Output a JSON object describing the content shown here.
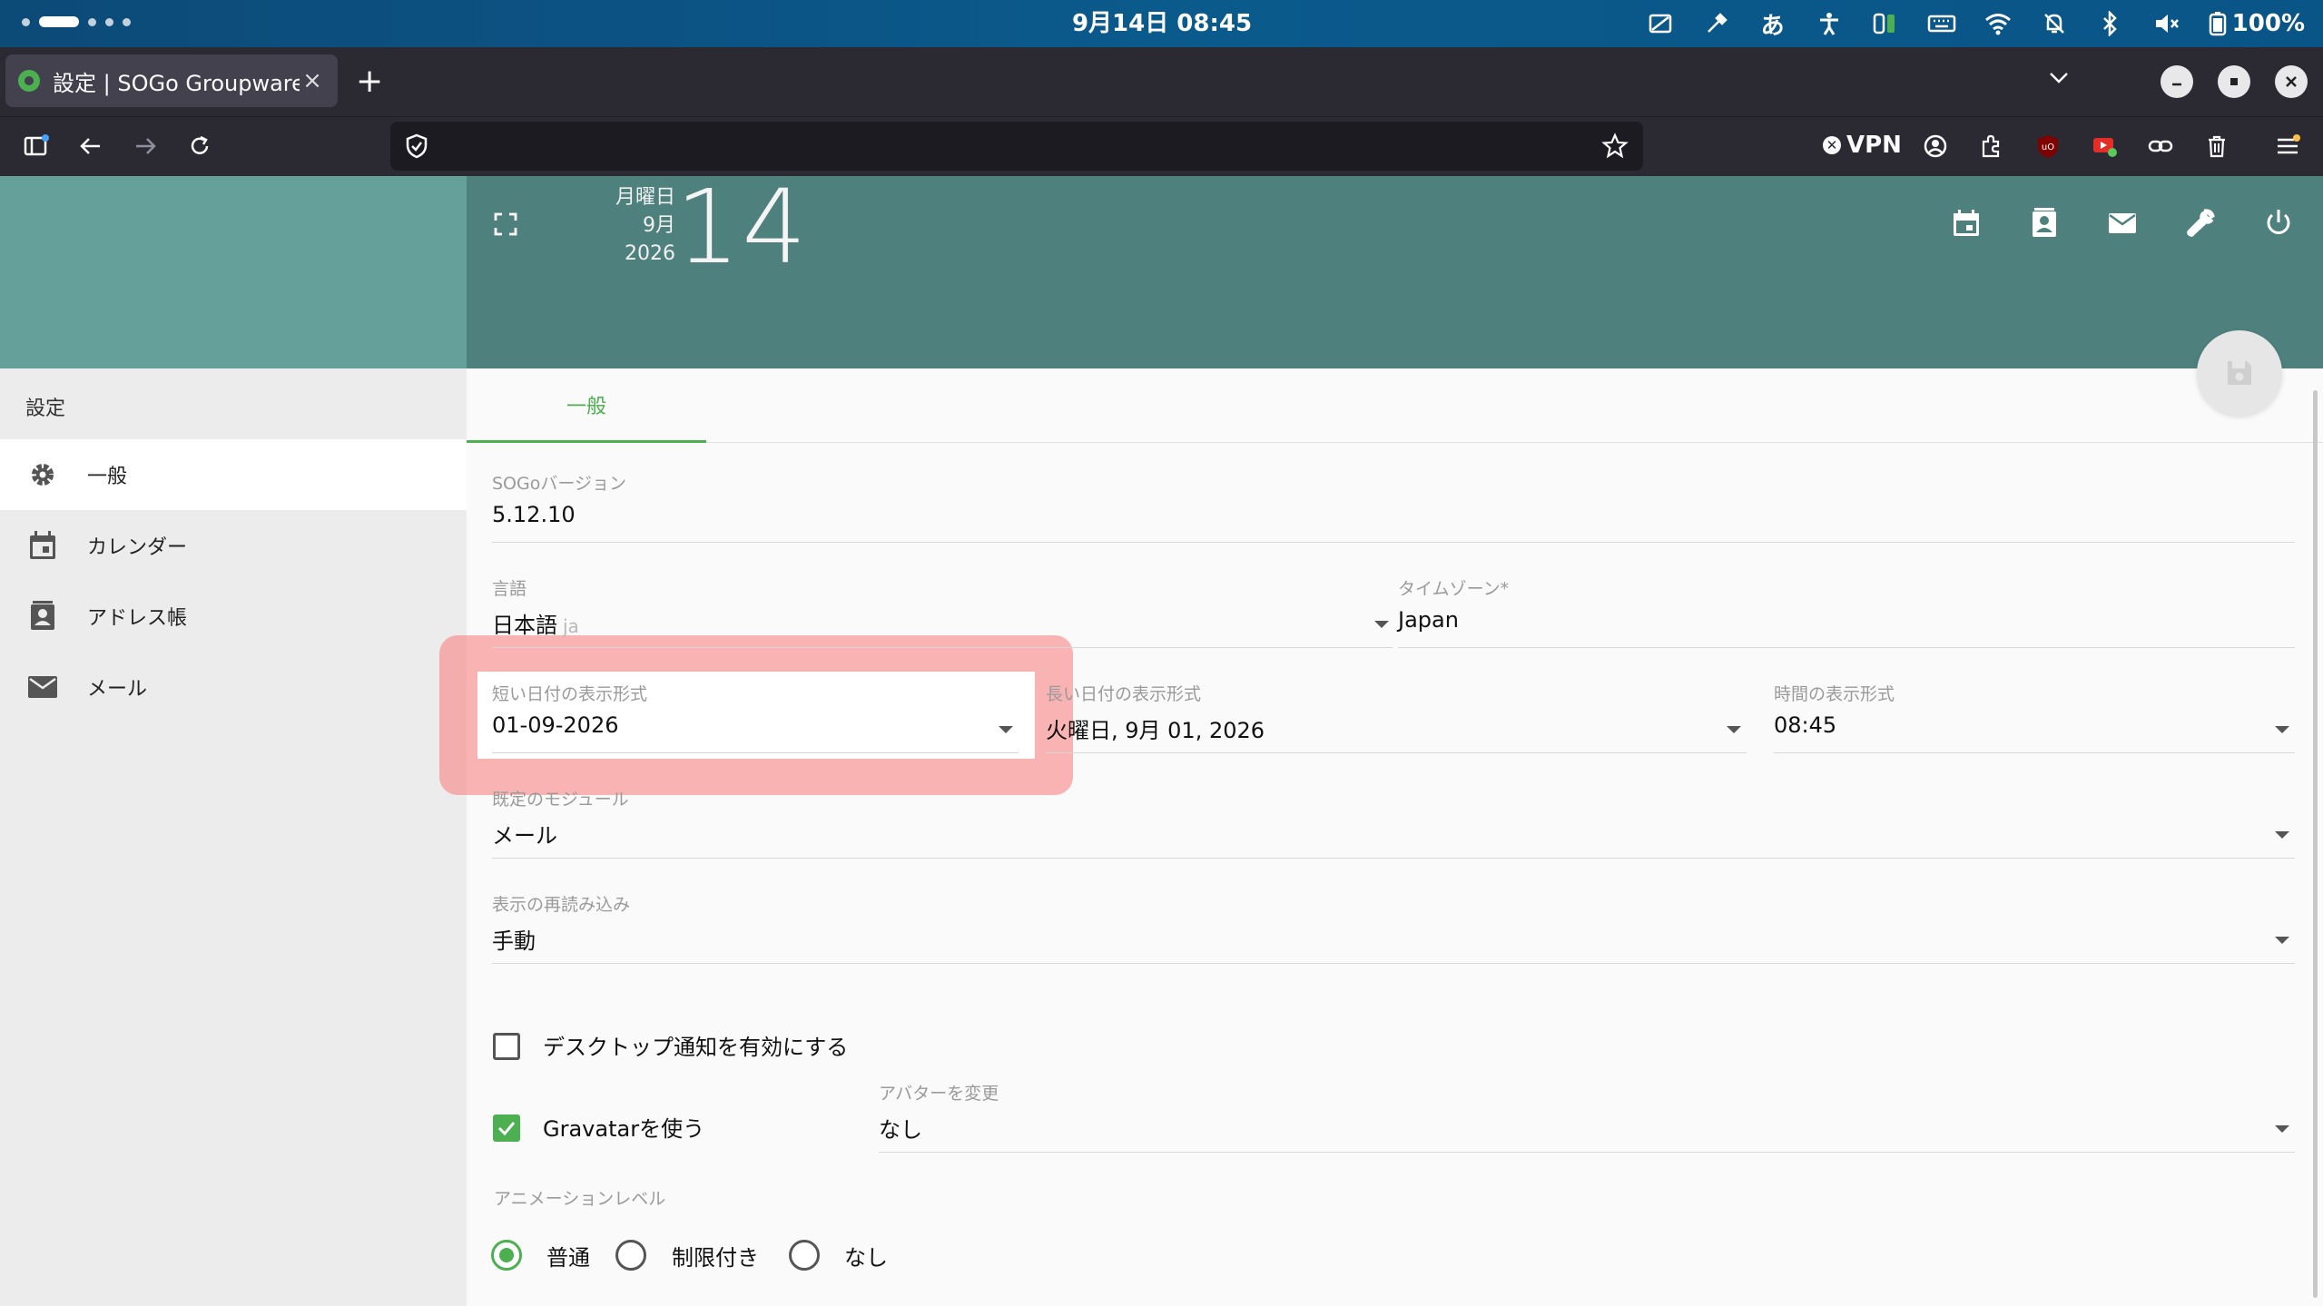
{
  "os": {
    "clock": "9月14日 08:45",
    "ime": "あ",
    "battery": "100%"
  },
  "browser": {
    "tab_title": "設定 | SOGo Groupware",
    "tab_close": "×",
    "new_tab": "+",
    "url": "",
    "vpn_label": "VPN"
  },
  "header": {
    "weekday": "月曜日",
    "month": "9月",
    "year": "2026",
    "day": "14"
  },
  "sidebar": {
    "title": "設定",
    "items": [
      {
        "label": "一般",
        "icon": "gear-icon"
      },
      {
        "label": "カレンダー",
        "icon": "calendar-icon"
      },
      {
        "label": "アドレス帳",
        "icon": "contacts-icon"
      },
      {
        "label": "メール",
        "icon": "mail-icon"
      }
    ]
  },
  "main": {
    "tab_general": "一般",
    "sogo_version": {
      "label": "SOGoバージョン",
      "value": "5.12.10"
    },
    "language": {
      "label": "言語",
      "value": "日本語",
      "code": "ja"
    },
    "timezone": {
      "label": "タイムゾーン*",
      "value": "Japan"
    },
    "short_date": {
      "label": "短い日付の表示形式",
      "value": "01-09-2026"
    },
    "long_date": {
      "label": "長い日付の表示形式",
      "value": "火曜日, 9月 01, 2026"
    },
    "time_format": {
      "label": "時間の表示形式",
      "value": "08:45"
    },
    "default_module": {
      "label": "既定のモジュール",
      "value": "メール"
    },
    "refresh": {
      "label": "表示の再読み込み",
      "value": "手動"
    },
    "desktop_notify": {
      "label": "デスクトップ通知を有効にする",
      "checked": false
    },
    "gravatar": {
      "label": "Gravatarを使う",
      "checked": true
    },
    "avatar": {
      "label": "アバターを変更",
      "value": "なし"
    },
    "animation": {
      "label": "アニメーションレベル",
      "options": [
        "普通",
        "制限付き",
        "なし"
      ],
      "selected": "普通"
    }
  },
  "colors": {
    "accent": "#4caf50",
    "header": "#4e807e",
    "header_left": "#66a09a",
    "highlight": "#f88080"
  }
}
